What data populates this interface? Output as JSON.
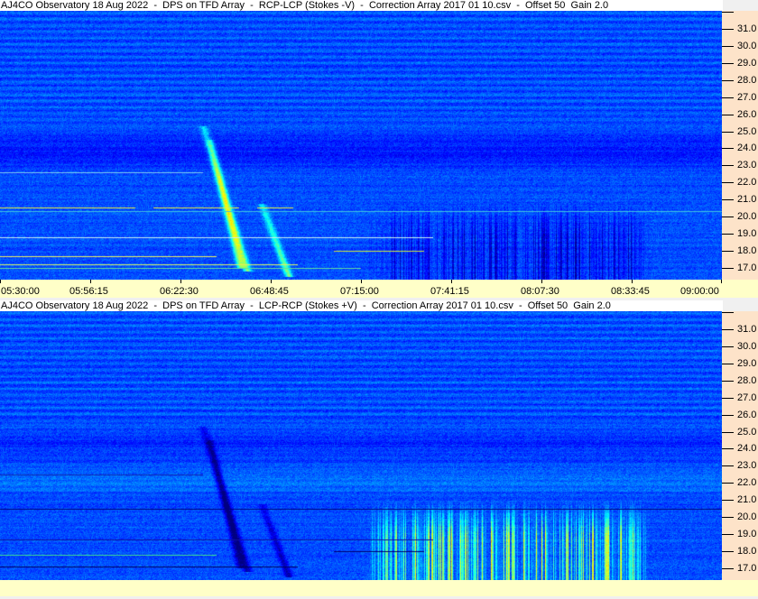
{
  "chart_data": [
    {
      "type": "heatmap",
      "title": "AJ4CO Observatory 18 Aug 2022  -  DPS on TFD Array  -  RCP-LCP (Stokes -V)  -  Correction Array 2017 01 10.csv  -  Offset 50  Gain 2.0",
      "polarity": "RCP-LCP",
      "xlabel": "",
      "ylabel": "",
      "x_ticks": [
        "05:30:00",
        "05:56:15",
        "06:22:30",
        "06:48:45",
        "07:15:00",
        "07:41:15",
        "08:07:30",
        "08:33:45",
        "09:00:00"
      ],
      "y_ticks": [
        "31.0",
        "30.0",
        "29.0",
        "28.0",
        "27.0",
        "26.0",
        "25.0",
        "24.0",
        "23.0",
        "22.0",
        "21.0",
        "20.0",
        "19.0",
        "18.0",
        "17.0"
      ],
      "xlim": [
        "05:30:00",
        "09:00:00"
      ],
      "ylim_mhz": [
        16.3,
        32.0
      ],
      "colormap": "jet",
      "events": [
        {
          "kind": "type-III burst",
          "start_min": 59,
          "end_min": 72,
          "f_start": 25.3,
          "f_end": 16.8,
          "sign": 1
        },
        {
          "kind": "type-III burst",
          "start_min": 61,
          "end_min": 70,
          "f_start": 24.5,
          "f_end": 17.0,
          "sign": 1
        },
        {
          "kind": "type-III burst",
          "start_min": 76,
          "end_min": 84,
          "f_start": 20.8,
          "f_end": 16.5,
          "sign": 1
        },
        {
          "kind": "storm",
          "start_min": 105,
          "end_min": 189,
          "f_start": 21.0,
          "f_end": 16.3,
          "sign": -1
        }
      ]
    },
    {
      "type": "heatmap",
      "title": "AJ4CO Observatory 18 Aug 2022  -  DPS on TFD Array  -  LCP-RCP (Stokes +V)  -  Correction Array 2017 01 10.csv  -  Offset 50  Gain 2.0",
      "polarity": "LCP-RCP",
      "y_ticks": [
        "31.0",
        "30.0",
        "29.0",
        "28.0",
        "27.0",
        "26.0",
        "25.0",
        "24.0",
        "23.0",
        "22.0",
        "21.0",
        "20.0",
        "19.0",
        "18.0",
        "17.0"
      ],
      "xlim": [
        "05:30:00",
        "09:00:00"
      ],
      "ylim_mhz": [
        16.3,
        32.0
      ],
      "colormap": "jet",
      "events": [
        {
          "kind": "type-III burst",
          "start_min": 59,
          "end_min": 72,
          "f_start": 25.3,
          "f_end": 16.8,
          "sign": -1
        },
        {
          "kind": "type-III burst",
          "start_min": 61,
          "end_min": 70,
          "f_start": 24.5,
          "f_end": 17.0,
          "sign": -1
        },
        {
          "kind": "type-III burst",
          "start_min": 76,
          "end_min": 84,
          "f_start": 20.8,
          "f_end": 16.5,
          "sign": -1
        },
        {
          "kind": "storm",
          "start_min": 105,
          "end_min": 189,
          "f_start": 21.0,
          "f_end": 16.3,
          "sign": 1
        }
      ]
    }
  ]
}
